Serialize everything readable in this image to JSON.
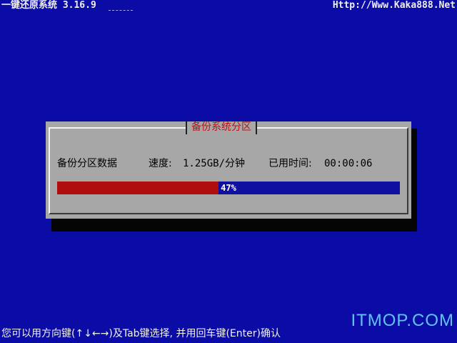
{
  "header": {
    "title": "一键还原系统 3.16.9",
    "website": "Http://Www.Kaka888.Net"
  },
  "dialog": {
    "title": "备份系统分区",
    "task_label": "备份分区数据",
    "speed_label": "速度:",
    "speed_value": "1.25GB/分钟",
    "elapsed_label": "已用时间:",
    "elapsed_value": "00:00:06",
    "progress_percent": 47,
    "progress_text": "47%"
  },
  "footer": {
    "hint": "您可以用方向键(↑↓←→)及Tab键选择, 并用回车键(Enter)确认",
    "watermark": "ITMOP.COM"
  },
  "colors": {
    "background": "#0b0ba6",
    "dialog": "#a7a7a7",
    "progress_fill": "#b00d0d",
    "progress_track": "#1010a0",
    "dialog_title": "#c21010"
  }
}
